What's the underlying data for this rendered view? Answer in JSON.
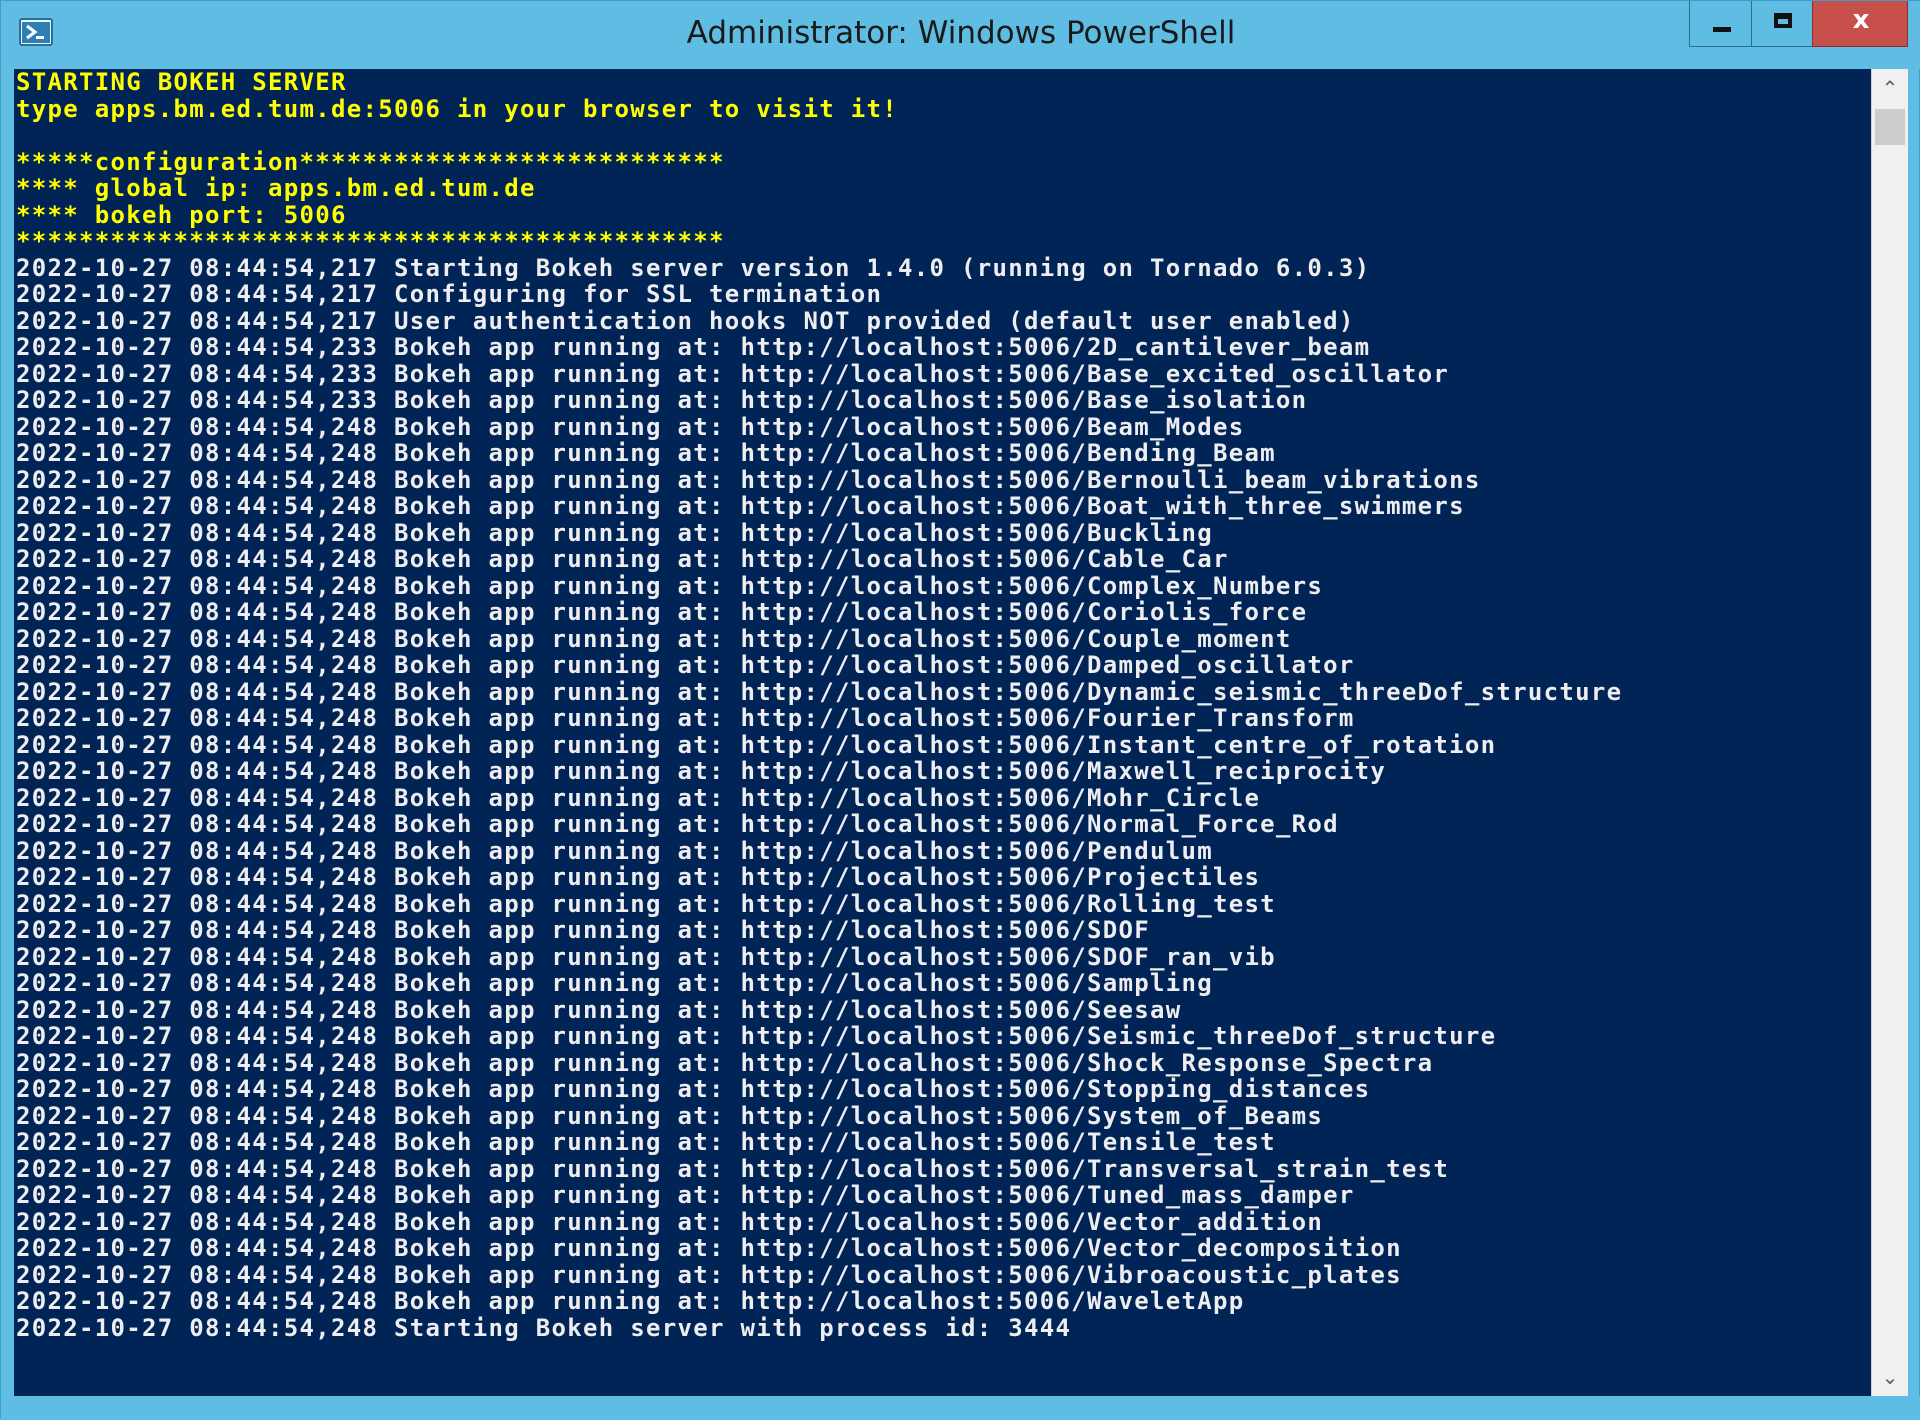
{
  "window": {
    "title": "Administrator: Windows PowerShell",
    "close_glyph": "x",
    "app_icon": "powershell-icon"
  },
  "colors": {
    "titlebar": "#5fbde3",
    "console_bg": "#012456",
    "yellow_text": "#ffff00",
    "white_text": "#eeedf0",
    "close_button": "#c7504a"
  },
  "console": {
    "header_lines": [
      "STARTING BOKEH SERVER",
      "type apps.bm.ed.tum.de:5006 in your browser to visit it!",
      "",
      "*****configuration***************************",
      "**** global ip: apps.bm.ed.tum.de",
      "**** bokeh port: 5006",
      "*********************************************"
    ],
    "log_lines": [
      "2022-10-27 08:44:54,217 Starting Bokeh server version 1.4.0 (running on Tornado 6.0.3)",
      "2022-10-27 08:44:54,217 Configuring for SSL termination",
      "2022-10-27 08:44:54,217 User authentication hooks NOT provided (default user enabled)",
      "2022-10-27 08:44:54,233 Bokeh app running at: http://localhost:5006/2D_cantilever_beam",
      "2022-10-27 08:44:54,233 Bokeh app running at: http://localhost:5006/Base_excited_oscillator",
      "2022-10-27 08:44:54,233 Bokeh app running at: http://localhost:5006/Base_isolation",
      "2022-10-27 08:44:54,248 Bokeh app running at: http://localhost:5006/Beam_Modes",
      "2022-10-27 08:44:54,248 Bokeh app running at: http://localhost:5006/Bending_Beam",
      "2022-10-27 08:44:54,248 Bokeh app running at: http://localhost:5006/Bernoulli_beam_vibrations",
      "2022-10-27 08:44:54,248 Bokeh app running at: http://localhost:5006/Boat_with_three_swimmers",
      "2022-10-27 08:44:54,248 Bokeh app running at: http://localhost:5006/Buckling",
      "2022-10-27 08:44:54,248 Bokeh app running at: http://localhost:5006/Cable_Car",
      "2022-10-27 08:44:54,248 Bokeh app running at: http://localhost:5006/Complex_Numbers",
      "2022-10-27 08:44:54,248 Bokeh app running at: http://localhost:5006/Coriolis_force",
      "2022-10-27 08:44:54,248 Bokeh app running at: http://localhost:5006/Couple_moment",
      "2022-10-27 08:44:54,248 Bokeh app running at: http://localhost:5006/Damped_oscillator",
      "2022-10-27 08:44:54,248 Bokeh app running at: http://localhost:5006/Dynamic_seismic_threeDof_structure",
      "2022-10-27 08:44:54,248 Bokeh app running at: http://localhost:5006/Fourier_Transform",
      "2022-10-27 08:44:54,248 Bokeh app running at: http://localhost:5006/Instant_centre_of_rotation",
      "2022-10-27 08:44:54,248 Bokeh app running at: http://localhost:5006/Maxwell_reciprocity",
      "2022-10-27 08:44:54,248 Bokeh app running at: http://localhost:5006/Mohr_Circle",
      "2022-10-27 08:44:54,248 Bokeh app running at: http://localhost:5006/Normal_Force_Rod",
      "2022-10-27 08:44:54,248 Bokeh app running at: http://localhost:5006/Pendulum",
      "2022-10-27 08:44:54,248 Bokeh app running at: http://localhost:5006/Projectiles",
      "2022-10-27 08:44:54,248 Bokeh app running at: http://localhost:5006/Rolling_test",
      "2022-10-27 08:44:54,248 Bokeh app running at: http://localhost:5006/SDOF",
      "2022-10-27 08:44:54,248 Bokeh app running at: http://localhost:5006/SDOF_ran_vib",
      "2022-10-27 08:44:54,248 Bokeh app running at: http://localhost:5006/Sampling",
      "2022-10-27 08:44:54,248 Bokeh app running at: http://localhost:5006/Seesaw",
      "2022-10-27 08:44:54,248 Bokeh app running at: http://localhost:5006/Seismic_threeDof_structure",
      "2022-10-27 08:44:54,248 Bokeh app running at: http://localhost:5006/Shock_Response_Spectra",
      "2022-10-27 08:44:54,248 Bokeh app running at: http://localhost:5006/Stopping_distances",
      "2022-10-27 08:44:54,248 Bokeh app running at: http://localhost:5006/System_of_Beams",
      "2022-10-27 08:44:54,248 Bokeh app running at: http://localhost:5006/Tensile_test",
      "2022-10-27 08:44:54,248 Bokeh app running at: http://localhost:5006/Transversal_strain_test",
      "2022-10-27 08:44:54,248 Bokeh app running at: http://localhost:5006/Tuned_mass_damper",
      "2022-10-27 08:44:54,248 Bokeh app running at: http://localhost:5006/Vector_addition",
      "2022-10-27 08:44:54,248 Bokeh app running at: http://localhost:5006/Vector_decomposition",
      "2022-10-27 08:44:54,248 Bokeh app running at: http://localhost:5006/Vibroacoustic_plates",
      "2022-10-27 08:44:54,248 Bokeh app running at: http://localhost:5006/WaveletApp",
      "2022-10-27 08:44:54,248 Starting Bokeh server with process id: 3444"
    ]
  },
  "scrollbar": {
    "up_glyph": "⌃",
    "down_glyph": "⌄"
  }
}
